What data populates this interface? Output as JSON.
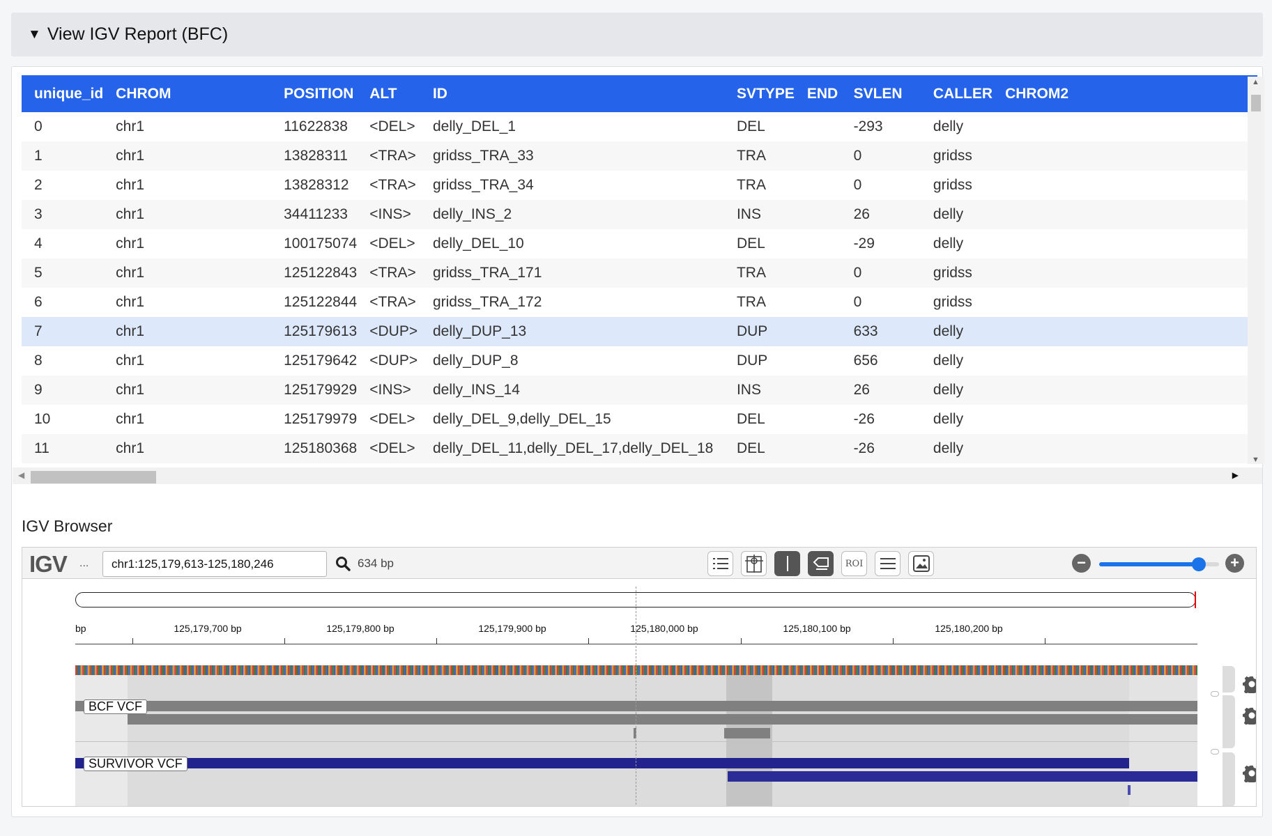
{
  "panel": {
    "title": "View IGV Report (BFC)"
  },
  "table": {
    "columns": [
      "unique_id",
      "CHROM",
      "POSITION",
      "ALT",
      "ID",
      "SVTYPE",
      "END",
      "SVLEN",
      "CALLER",
      "CHROM2"
    ],
    "rows": [
      [
        "0",
        "chr1",
        "11622838",
        "<DEL>",
        "delly_DEL_1",
        "DEL",
        "",
        "-293",
        "delly",
        ""
      ],
      [
        "1",
        "chr1",
        "13828311",
        "<TRA>",
        "gridss_TRA_33",
        "TRA",
        "",
        "0",
        "gridss",
        ""
      ],
      [
        "2",
        "chr1",
        "13828312",
        "<TRA>",
        "gridss_TRA_34",
        "TRA",
        "",
        "0",
        "gridss",
        ""
      ],
      [
        "3",
        "chr1",
        "34411233",
        "<INS>",
        "delly_INS_2",
        "INS",
        "",
        "26",
        "delly",
        ""
      ],
      [
        "4",
        "chr1",
        "100175074",
        "<DEL>",
        "delly_DEL_10",
        "DEL",
        "",
        "-29",
        "delly",
        ""
      ],
      [
        "5",
        "chr1",
        "125122843",
        "<TRA>",
        "gridss_TRA_171",
        "TRA",
        "",
        "0",
        "gridss",
        ""
      ],
      [
        "6",
        "chr1",
        "125122844",
        "<TRA>",
        "gridss_TRA_172",
        "TRA",
        "",
        "0",
        "gridss",
        ""
      ],
      [
        "7",
        "chr1",
        "125179613",
        "<DUP>",
        "delly_DUP_13",
        "DUP",
        "",
        "633",
        "delly",
        ""
      ],
      [
        "8",
        "chr1",
        "125179642",
        "<DUP>",
        "delly_DUP_8",
        "DUP",
        "",
        "656",
        "delly",
        ""
      ],
      [
        "9",
        "chr1",
        "125179929",
        "<INS>",
        "delly_INS_14",
        "INS",
        "",
        "26",
        "delly",
        ""
      ],
      [
        "10",
        "chr1",
        "125179979",
        "<DEL>",
        "delly_DEL_9,delly_DEL_15",
        "DEL",
        "",
        "-26",
        "delly",
        ""
      ],
      [
        "11",
        "chr1",
        "125180368",
        "<DEL>",
        "delly_DEL_11,delly_DEL_17,delly_DEL_18",
        "DEL",
        "",
        "-26",
        "delly",
        ""
      ]
    ],
    "selected_row": 7
  },
  "igv": {
    "section_title": "IGV Browser",
    "logo": "IGV",
    "ellipsis": "...",
    "locus": "chr1:125,179,613-125,180,246",
    "bp_count": "634 bp",
    "roi_label": "ROI",
    "zoom_level": 0.83,
    "ruler_unit": "bp",
    "ticks": [
      "125,179,700 bp",
      "125,179,800 bp",
      "125,179,900 bp",
      "125,180,000 bp",
      "125,180,100 bp",
      "125,180,200 bp"
    ],
    "tracks": [
      {
        "name": "BCF VCF",
        "color": "#808080"
      },
      {
        "name": "SURVIVOR VCF",
        "color": "#23238e"
      }
    ],
    "accent_color": "#2563eb"
  }
}
